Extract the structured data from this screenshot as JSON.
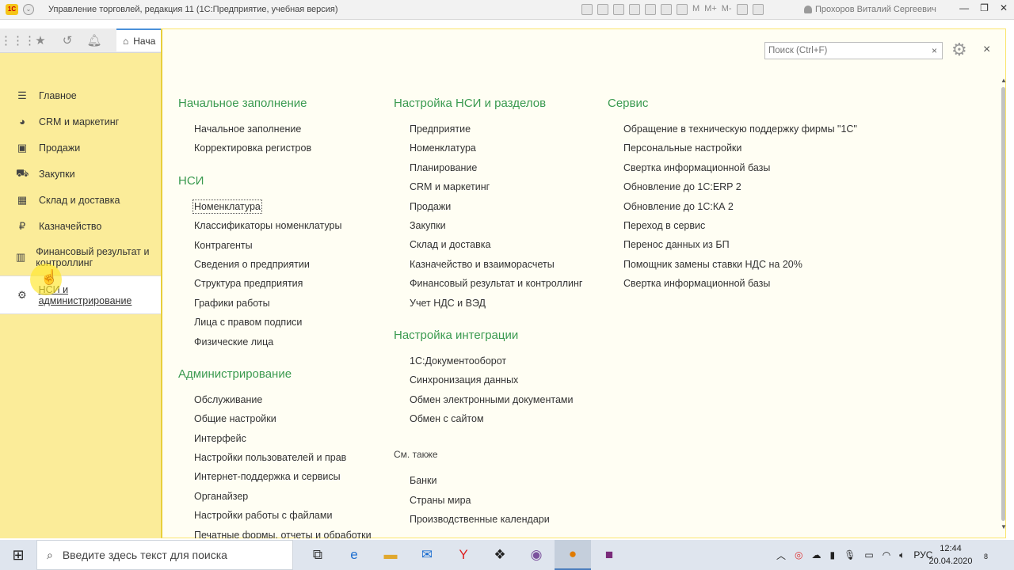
{
  "window": {
    "logo": "1С",
    "title": "Управление торговлей, редакция 11  (1С:Предприятие, учебная версия)",
    "tools": [
      "M",
      "M+",
      "M-"
    ],
    "user": "Прохоров Виталий Сергеевич",
    "controls": [
      "—",
      "❐",
      "✕"
    ]
  },
  "toolbar": {
    "home_tab": "Нача",
    "icons": [
      "apps-icon",
      "star-icon",
      "history-icon",
      "bell-icon"
    ]
  },
  "sidebar": {
    "items": [
      {
        "label": "Главное",
        "icon": "☰"
      },
      {
        "label": "CRM и маркетинг",
        "icon": "◕"
      },
      {
        "label": "Продажи",
        "icon": "▣"
      },
      {
        "label": "Закупки",
        "icon": "⛟"
      },
      {
        "label": "Склад и доставка",
        "icon": "▦"
      },
      {
        "label": "Казначейство",
        "icon": "₽"
      },
      {
        "label": "Финансовый результат и контроллинг",
        "icon": "▥"
      },
      {
        "label": "НСИ и администрирование",
        "icon": "⚙"
      }
    ],
    "active_index": 7
  },
  "search": {
    "placeholder": "Поиск (Ctrl+F)",
    "value": ""
  },
  "sections": {
    "initial": {
      "title": "Начальное заполнение",
      "links": [
        "Начальное заполнение",
        "Корректировка регистров"
      ]
    },
    "nsi": {
      "title": "НСИ",
      "links": [
        "Номенклатура",
        "Классификаторы номенклатуры",
        "Контрагенты",
        "Сведения о предприятии",
        "Структура предприятия",
        "Графики работы",
        "Лица с правом подписи",
        "Физические лица"
      ]
    },
    "admin": {
      "title": "Администрирование",
      "links": [
        "Обслуживание",
        "Общие настройки",
        "Интерфейс",
        "Настройки пользователей и прав",
        "Интернет-поддержка и сервисы",
        "Органайзер",
        "Настройки работы с файлами",
        "Печатные формы, отчеты и обработки"
      ]
    },
    "nsi_setup": {
      "title": "Настройка НСИ и разделов",
      "links": [
        "Предприятие",
        "Номенклатура",
        "Планирование",
        "CRM и маркетинг",
        "Продажи",
        "Закупки",
        "Склад и доставка",
        "Казначейство и взаиморасчеты",
        "Финансовый результат и контроллинг",
        "Учет НДС и ВЭД"
      ]
    },
    "integration": {
      "title": "Настройка интеграции",
      "links": [
        "1С:Документооборот",
        "Синхронизация данных",
        "Обмен электронными документами",
        "Обмен с сайтом"
      ]
    },
    "see_also": {
      "title": "См. также",
      "links": [
        "Банки",
        "Страны мира",
        "Производственные календари"
      ]
    },
    "service": {
      "title": "Сервис",
      "links": [
        "Обращение в техническую поддержку фирмы \"1С\"",
        "Персональные настройки",
        "Свертка информационной базы",
        "Обновление до 1С:ERP 2",
        "Обновление до 1С:КА 2",
        "Переход в сервис",
        "Перенос данных из БП",
        "Помощник замены ставки НДС на 20%",
        "Свертка информационной базы"
      ]
    }
  },
  "taskbar": {
    "search_placeholder": "Введите здесь текст для поиска",
    "language": "РУС",
    "time": "12:44",
    "date": "20.04.2020",
    "notifications": "8"
  }
}
